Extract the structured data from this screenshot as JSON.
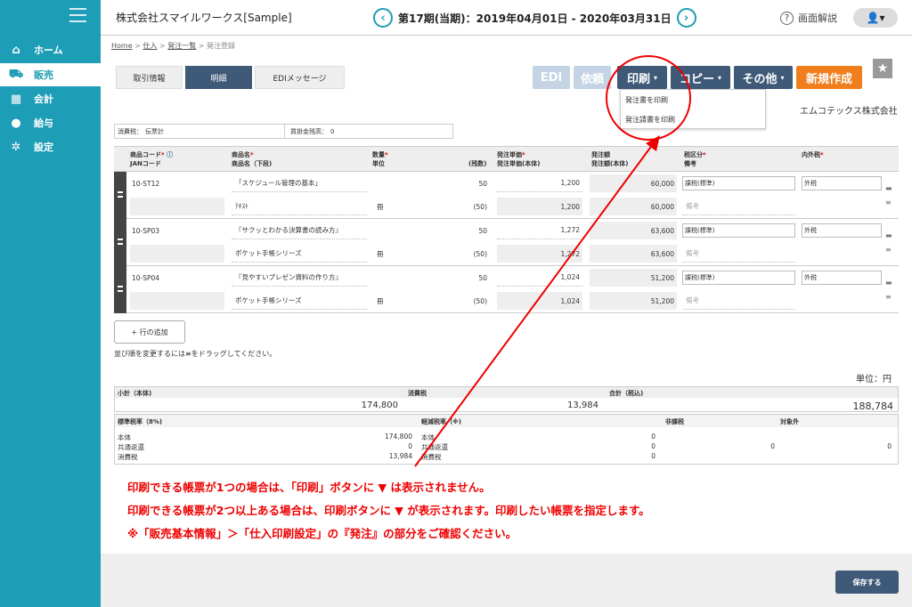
{
  "sidebar": {
    "items": [
      {
        "label": "ホーム",
        "icon": "home-icon"
      },
      {
        "label": "販売",
        "icon": "cart-icon"
      },
      {
        "label": "会計",
        "icon": "calculator-icon"
      },
      {
        "label": "給与",
        "icon": "money-bag-icon"
      },
      {
        "label": "設定",
        "icon": "gear-icon"
      }
    ]
  },
  "header": {
    "company": "株式会社スマイルワークス[Sample]",
    "period": "第17期(当期)：2019年04月01日 - 2020年03月31日",
    "prev_icon": "chevron-left-icon",
    "next_icon": "chevron-right-icon",
    "help": "画面解説",
    "user_icon": "user-icon"
  },
  "breadcrumb": [
    "Home",
    "仕入",
    "発注一覧",
    "発注登録"
  ],
  "tabs": [
    "取引情報",
    "明細",
    "EDIメッセージ"
  ],
  "toolbar": {
    "edi": "EDI",
    "request": "依頼",
    "print": "印刷",
    "copy": "コピー",
    "other": "その他",
    "new": "新規作成"
  },
  "print_menu": [
    "発注書を印刷",
    "発注請書を印刷"
  ],
  "supplier": "エムコテックス株式会社",
  "meta": {
    "tax_label": "消費税：",
    "tax_value": "伝票計",
    "balance_label": "買掛金残高：",
    "balance_value": "0"
  },
  "grid_headers": {
    "code": "商品コード",
    "jan": "JANコード",
    "name": "商品名",
    "name2": "商品名（下段)",
    "qty": "数量",
    "unit": "単位",
    "count": "(残数)",
    "price": "発注単価",
    "price2": "発注単価(本体)",
    "amount": "発注額",
    "amount2": "発注額(本体)",
    "taxcat": "税区分",
    "memo": "備考",
    "intax": "内外税"
  },
  "rows": [
    {
      "code": "10-ST12",
      "name": "「スケジュール管理の基本」",
      "name2": "ﾃｷｽﾄ",
      "unit": "冊",
      "qty": "50",
      "remain": "(50)",
      "price": "1,200",
      "price2": "1,200",
      "amount": "60,000",
      "amount2": "60,000",
      "taxcat": "課税(標準)",
      "intax": "外税",
      "memo": "備考"
    },
    {
      "code": "10-SP03",
      "name": "『サクッとわかる決算書の読み方』",
      "name2": "ポケット手帳シリーズ",
      "unit": "冊",
      "qty": "50",
      "remain": "(50)",
      "price": "1,272",
      "price2": "1,272",
      "amount": "63,600",
      "amount2": "63,600",
      "taxcat": "課税(標準)",
      "intax": "外税",
      "memo": "備考"
    },
    {
      "code": "10-SP04",
      "name": "『見やすいプレゼン資料の作り方』",
      "name2": "ポケット手帳シリーズ",
      "unit": "冊",
      "qty": "50",
      "remain": "(50)",
      "price": "1,024",
      "price2": "1,024",
      "amount": "51,200",
      "amount2": "51,200",
      "taxcat": "課税(標準)",
      "intax": "外税",
      "memo": "備考"
    }
  ],
  "add_row": "+ 行の追加",
  "drag_hint": "並び順を変更するには≡をドラッグしてください。",
  "unit_label": "単位：円",
  "totals": {
    "subtotal_label": "小計（本体)",
    "subtotal": "174,800",
    "tax_label": "消費税",
    "tax": "13,984",
    "total_label": "合計（税込)",
    "total": "188,784"
  },
  "tax_breakdown": {
    "standard_label": "標準税率（8%)",
    "reduced_label": "軽減税率（※)",
    "exempt_label": "非課税",
    "out_label": "対象外",
    "body_label": "本体",
    "return_label": "共通返還",
    "ctax_label": "消費税",
    "standard": [
      "174,800",
      "0",
      "13,984"
    ],
    "reduced": [
      "0",
      "0",
      "0"
    ],
    "exempt": "0",
    "out": "0"
  },
  "annotation": [
    "印刷できる帳票が1つの場合は、「印刷」ボタンに ▼ は表示されません。",
    "印刷できる帳票が2つ以上ある場合は、印刷ボタンに ▼ が表示されます。印刷したい帳票を指定します。",
    "※「販売基本情報」＞「仕入印刷設定」の『発注』の部分をご確認ください。"
  ],
  "save": "保存する",
  "colors": {
    "sidebar": "#1e9db6",
    "tab_active": "#3e5a78",
    "new_button": "#f07e1c",
    "disabled_button": "#c4d4e4",
    "annotation": "#e00000"
  }
}
